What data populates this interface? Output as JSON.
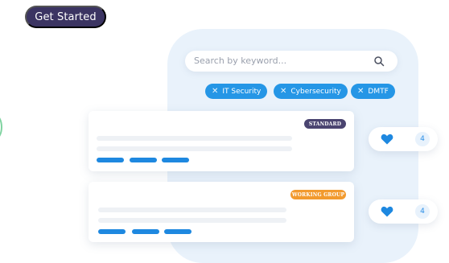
{
  "header": {
    "cta_label": "Get Started"
  },
  "search": {
    "placeholder": "Search by keyword..."
  },
  "filters": [
    {
      "label": "IT Security"
    },
    {
      "label": "Cybersecurity"
    },
    {
      "label": "DMTF"
    }
  ],
  "cards": [
    {
      "badge": "STANDARD",
      "badge_color": "#4a4470",
      "likes": "4"
    },
    {
      "badge": "WORKING GROUP",
      "badge_color": "#f29a2e",
      "likes": "4"
    }
  ],
  "colors": {
    "accent": "#2596e6",
    "brand_dark": "#3b3462",
    "panel": "#e9f2fb"
  },
  "icons": {
    "search": "search-icon",
    "remove_filter": "close-icon",
    "like": "heart-icon"
  }
}
